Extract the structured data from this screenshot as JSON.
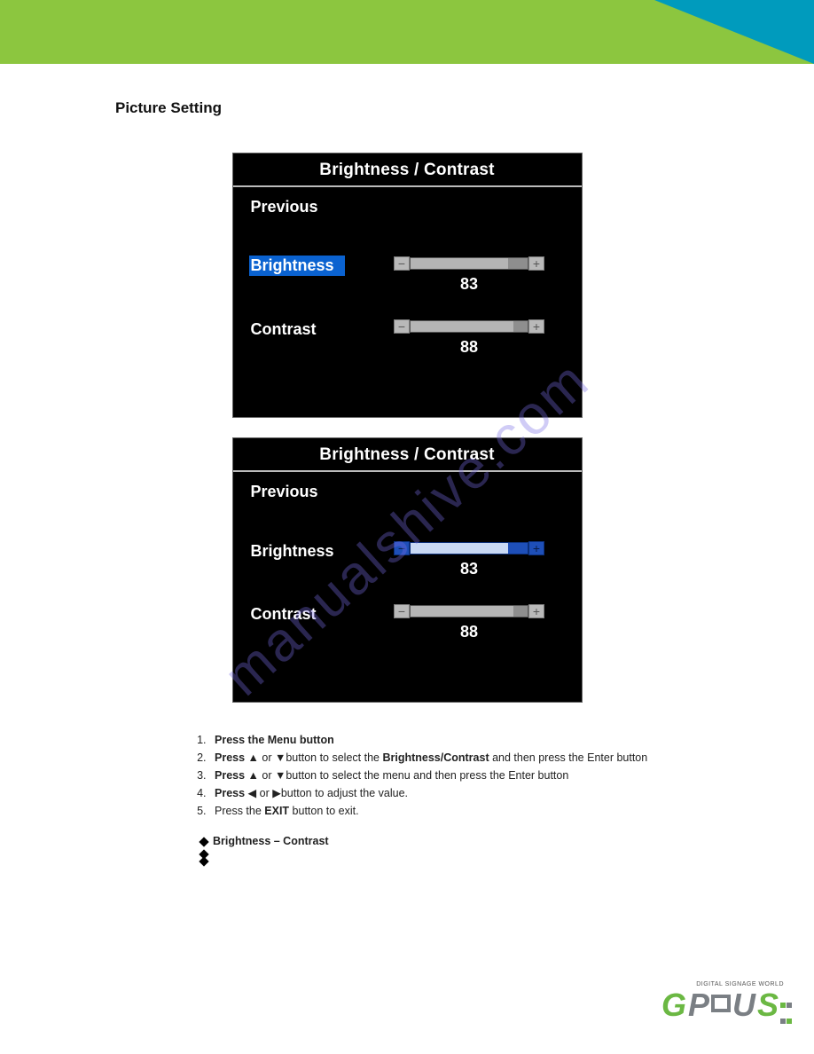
{
  "section_title": "Picture Setting",
  "watermark": "manualshive.com",
  "osd": {
    "title": "Brightness / Contrast",
    "previous": "Previous",
    "brightness": {
      "label": "Brightness",
      "value": "83",
      "pct": 83
    },
    "contrast": {
      "label": "Contrast",
      "value": "88",
      "pct": 88
    }
  },
  "instructions": {
    "items": [
      {
        "prefix": "Press the Menu button",
        "bold_prefix": true
      },
      {
        "pre": "Press ",
        "mid": " or ",
        "post": "button to select the ",
        "bold2": "Brightness/Contrast",
        "post2": " and then press the Enter button",
        "arrows": "ud",
        "bold_pre": true
      },
      {
        "pre": "Press ",
        "mid": " or ",
        "post": "button to select the menu and then press the Enter button",
        "arrows": "ud",
        "bold_pre": true
      },
      {
        "pre": "Press ",
        "mid": " or ",
        "post": "button to adjust the value.",
        "arrows": "lr",
        "bold_pre": true
      },
      {
        "pre": "Press the ",
        "bold2": "EXIT",
        "post2": " button to exit."
      }
    ]
  },
  "bullets": [
    "Brightness – Contrast",
    "",
    ""
  ],
  "footer": {
    "tagline": "DIGITAL SIGNAGE WORLD",
    "logo_g": "G",
    "logo_p": "P",
    "logo_u": "U",
    "logo_s": "S"
  }
}
